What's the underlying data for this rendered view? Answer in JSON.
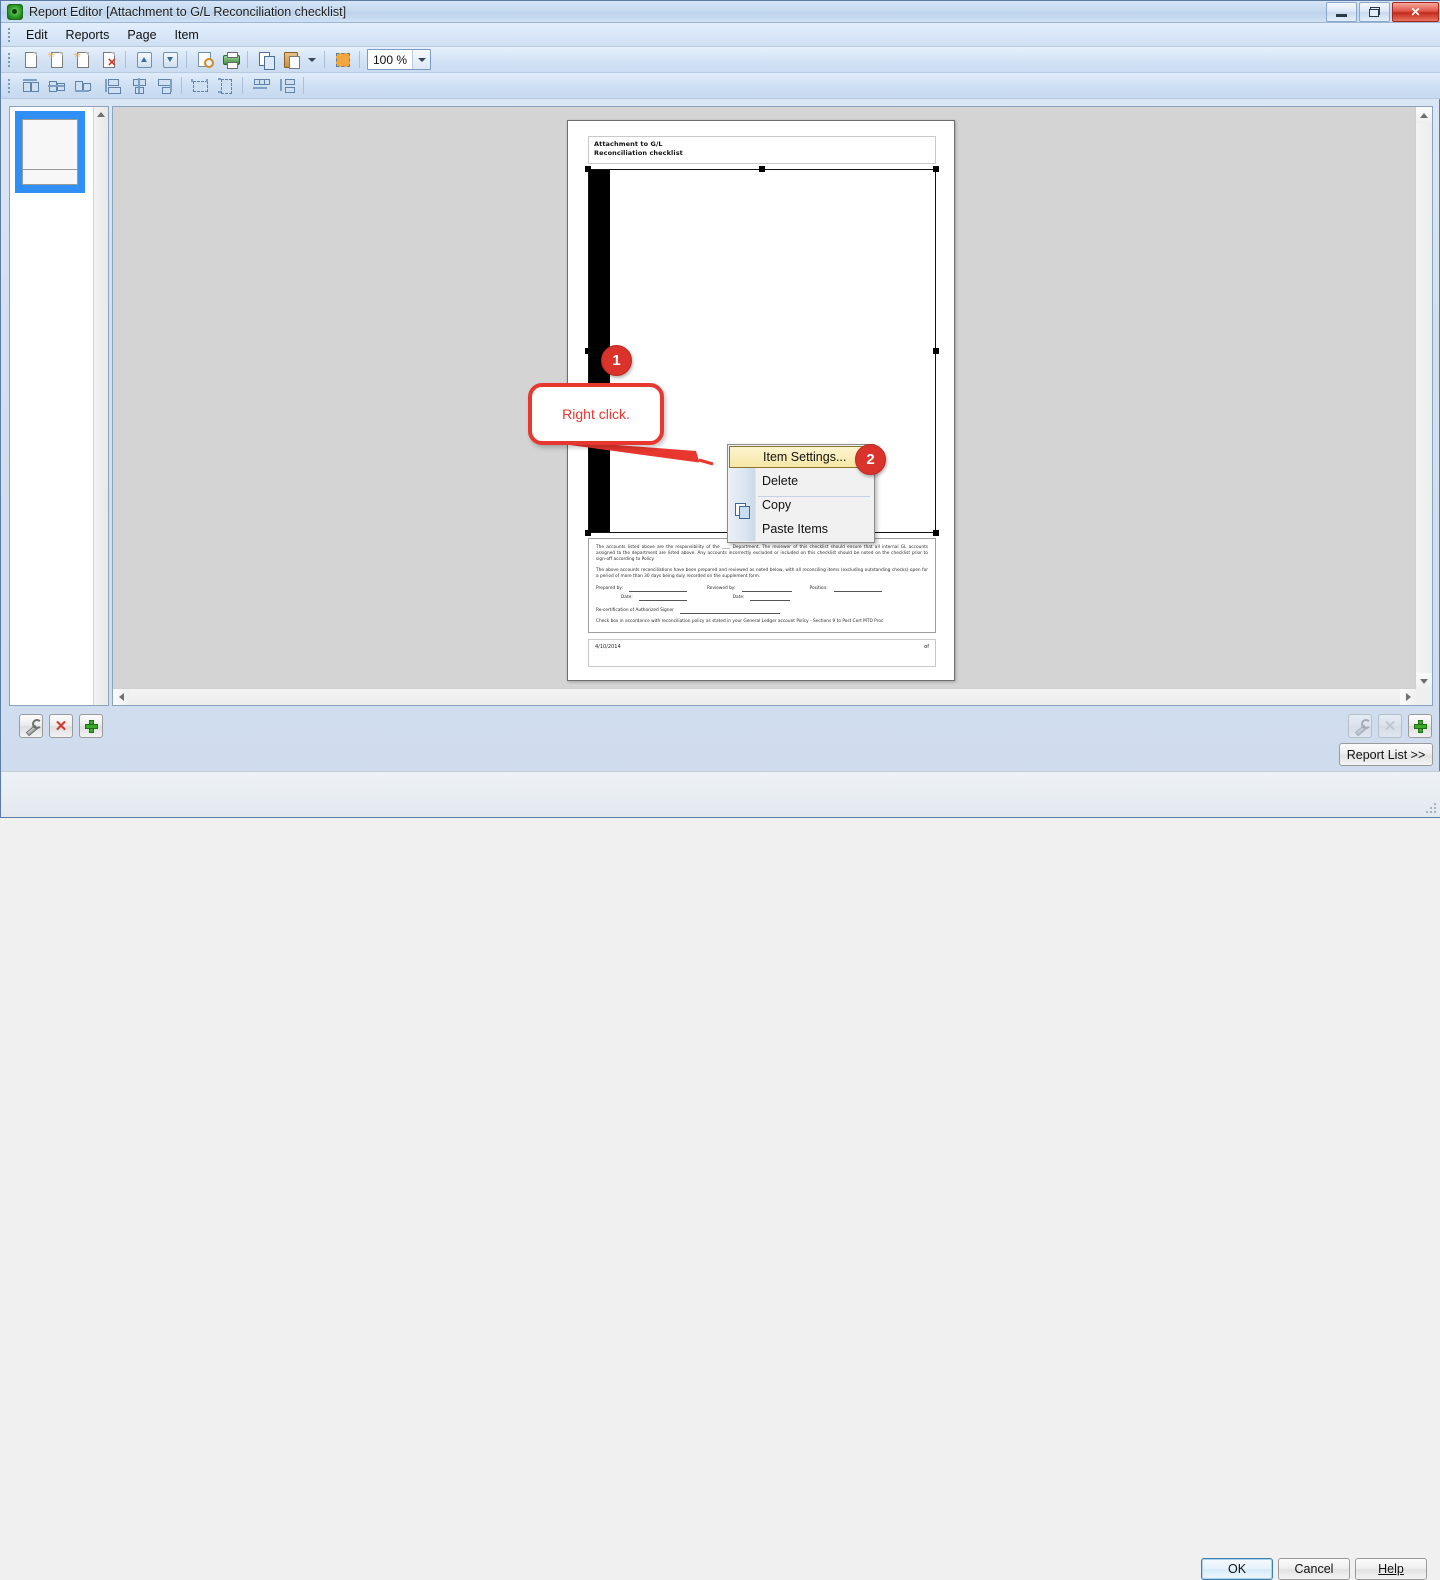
{
  "window": {
    "title": "Report Editor [Attachment to G/L Reconciliation checklist]",
    "app_icon": "report-editor-icon",
    "controls": {
      "minimize": "minimize-icon",
      "restore": "restore-icon",
      "close": "close-icon"
    }
  },
  "menubar": {
    "items": [
      {
        "label": "Edit"
      },
      {
        "label": "Reports"
      },
      {
        "label": "Page"
      },
      {
        "label": "Item"
      }
    ]
  },
  "toolbar_main": {
    "buttons": [
      {
        "name": "open-report-icon"
      },
      {
        "name": "new-page-icon"
      },
      {
        "name": "new-page-copy-icon"
      },
      {
        "name": "delete-page-icon"
      },
      {
        "name": "move-up-icon"
      },
      {
        "name": "move-down-icon"
      },
      {
        "name": "print-preview-icon"
      },
      {
        "name": "print-icon"
      },
      {
        "name": "copy-icon"
      },
      {
        "name": "paste-icon"
      },
      {
        "name": "snap-to-grid-icon"
      }
    ],
    "zoom": {
      "value": "100 %",
      "dropdown_icon": "chevron-down-icon"
    }
  },
  "toolbar_align": {
    "buttons": [
      {
        "name": "align-top-icon"
      },
      {
        "name": "align-middle-icon"
      },
      {
        "name": "align-bottom-icon"
      },
      {
        "name": "align-left-icon"
      },
      {
        "name": "align-center-icon"
      },
      {
        "name": "align-right-icon"
      },
      {
        "name": "same-width-icon"
      },
      {
        "name": "same-height-icon"
      },
      {
        "name": "space-horizontal-icon"
      },
      {
        "name": "space-vertical-icon"
      }
    ]
  },
  "thumbnails": {
    "pages": [
      {
        "label": "",
        "selected": true
      }
    ]
  },
  "document": {
    "header": {
      "line1": "Attachment to G/L",
      "line2": "Reconciliation checklist"
    },
    "body": {
      "black_bar": true,
      "selected": true
    },
    "footer_block": {
      "paragraph1": "The accounts listed above are the responsibility of the ____ Department. The reviewer of this checklist should ensure that all internal GL accounts assigned to the department are listed above. Any accounts incorrectly excluded or included on this checklist should be noted on the checklist prior to sign-off according to Policy.",
      "paragraph2": "The above accounts reconciliations have been prepared and reviewed as noted below, with all reconciling items (excluding outstanding checks) open for a period of more than 30 days being duly recorded on the supplement form.",
      "prepared_by_label": "Prepared by:",
      "reviewed_by_label": "Reviewed by:",
      "position_label": "Position:",
      "date_label_1": "Date:",
      "date_label_2": "Date:",
      "recert_label": "Re-certification of Authorized Signer",
      "note": "Check box in accordance with reconciliation policy as stated in your General Ledger account Policy - Sections 9 to Post Cert MTD Proc"
    },
    "page_footer": {
      "date": "4/10/2014",
      "page_marker": "of"
    }
  },
  "context_menu": {
    "items": [
      {
        "label": "Item Settings...",
        "selected": true,
        "icon": ""
      },
      {
        "label": "Delete",
        "selected": false,
        "icon": ""
      },
      {
        "label": "Copy",
        "selected": false,
        "icon": "copy-icon"
      },
      {
        "label": "Paste Items",
        "selected": false,
        "icon": ""
      }
    ]
  },
  "annotations": {
    "balloon_text": "Right click.",
    "marker_1": "1",
    "marker_2": "2",
    "accent_color": "#e8372f",
    "marker_color": "#d9332c"
  },
  "bottom_left_tools": [
    {
      "name": "settings-wrench-button",
      "disabled": false
    },
    {
      "name": "delete-x-button",
      "disabled": false
    },
    {
      "name": "add-plus-button",
      "disabled": false
    }
  ],
  "bottom_right_tools": [
    {
      "name": "settings-wrench-button",
      "disabled": true
    },
    {
      "name": "delete-x-button",
      "disabled": true
    },
    {
      "name": "add-plus-button",
      "disabled": false
    }
  ],
  "buttons": {
    "report_list": "Report List >>",
    "ok": "OK",
    "cancel": "Cancel",
    "help": "Help"
  }
}
